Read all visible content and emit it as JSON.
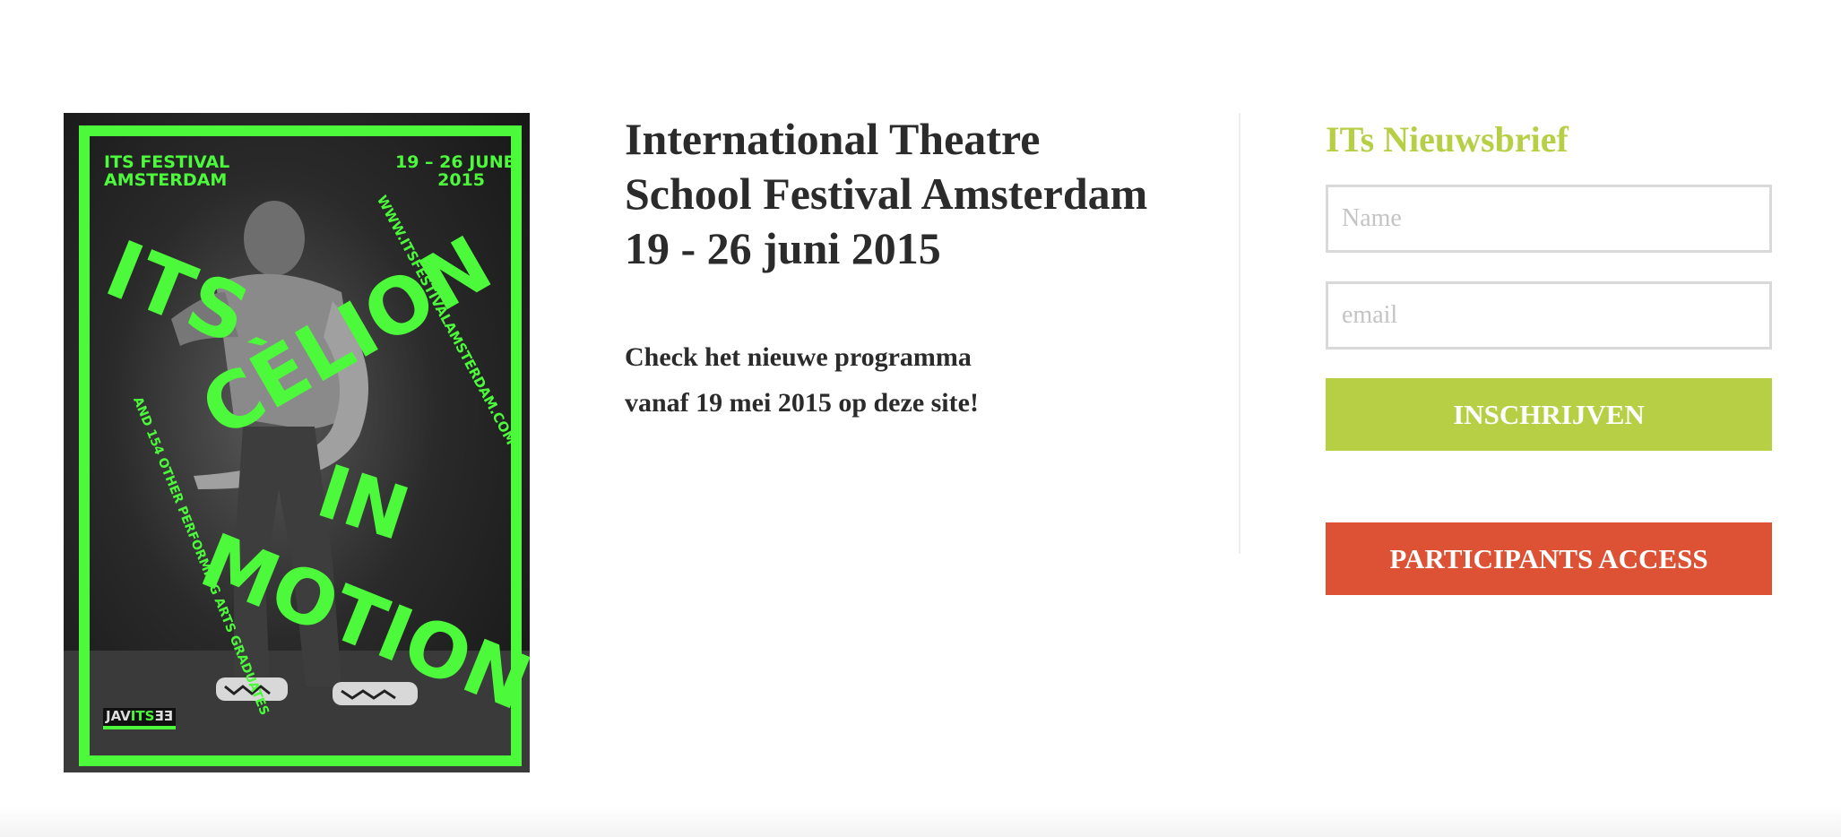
{
  "poster": {
    "festival": "ITS FESTIVAL\nAMSTERDAM",
    "dates": "19 – 26 JUNE\n2015",
    "url": "WWW.ITSFESTIVALAMSTERDAM.COM",
    "side_text": "AND 154 OTHER PERFORMING ARTS GRADUATES",
    "word_its": "ITS",
    "word_celion": "CÈLION",
    "word_in": "IN",
    "word_motion": "MOTION",
    "logo_a": "JAV",
    "logo_b": "ITS",
    "logo_c": "ƎƎ",
    "accent_color": "#4cfa3b"
  },
  "main": {
    "title_lines": [
      "International Theatre",
      "School Festival Amsterdam",
      "19 - 26 juni 2015"
    ],
    "sub_lines": [
      "Check het nieuwe programma",
      "vanaf 19 mei 2015 op deze site!"
    ]
  },
  "newsletter": {
    "title": "ITs Nieuwsbrief",
    "name_placeholder": "Name",
    "email_placeholder": "email",
    "subscribe_label": "INSCHRIJVEN",
    "participants_label": "PARTICIPANTS ACCESS",
    "accent_color": "#b6cf45",
    "participants_color": "#dd5134"
  }
}
